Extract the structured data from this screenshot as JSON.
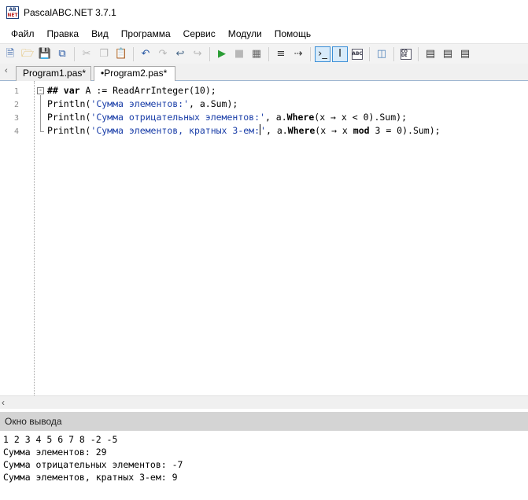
{
  "window": {
    "title": "PascalABC.NET 3.7.1",
    "icon_letters_top": "AB",
    "icon_letters_bottom": "NET"
  },
  "menu": [
    "Файл",
    "Правка",
    "Вид",
    "Программа",
    "Сервис",
    "Модули",
    "Помощь"
  ],
  "toolbar": {
    "icons": [
      "new-file-icon",
      "open-folder-icon",
      "save-icon",
      "save-all-icon",
      "cut-icon",
      "copy-icon",
      "paste-icon",
      "undo-icon",
      "redo-icon",
      "compile-icon",
      "stop-compile-icon",
      "run-icon",
      "stop-icon",
      "debug-icon",
      "step-icon",
      "step-over-icon",
      "console-icon",
      "format-icon",
      "abc-icon",
      "insert-snippet-icon",
      "code-icon",
      "bookmark-d-icon",
      "bookmark-l-icon",
      "bookmark-r-icon"
    ],
    "code_button_label": "CO DE",
    "abc_button_label": "ABC"
  },
  "tabs": [
    {
      "label": "Program1.pas*",
      "active": false
    },
    {
      "label": "•Program2.pas*",
      "active": true
    }
  ],
  "editor": {
    "line_numbers": [
      "1",
      "2",
      "3",
      "4"
    ],
    "lines": [
      [
        {
          "t": "## ",
          "c": "kw"
        },
        {
          "t": "var",
          "c": "kw"
        },
        {
          "t": " A := ReadArrInteger(",
          "c": "op"
        },
        {
          "t": "10",
          "c": "num"
        },
        {
          "t": ");",
          "c": "op"
        }
      ],
      [
        {
          "t": "Println(",
          "c": "op"
        },
        {
          "t": "'Сумма элементов:'",
          "c": "str"
        },
        {
          "t": ", a.Sum);",
          "c": "op"
        }
      ],
      [
        {
          "t": "Println(",
          "c": "op"
        },
        {
          "t": "'Сумма отрицательных элементов:'",
          "c": "str"
        },
        {
          "t": ", a.",
          "c": "op"
        },
        {
          "t": "Where",
          "c": "kw"
        },
        {
          "t": "(x → x < ",
          "c": "op"
        },
        {
          "t": "0",
          "c": "num"
        },
        {
          "t": ").Sum);",
          "c": "op"
        }
      ],
      [
        {
          "t": "Println(",
          "c": "op"
        },
        {
          "t": "'Сумма элементов, кратных 3-ем:",
          "c": "str"
        },
        {
          "t": "|caret|",
          "c": "caret"
        },
        {
          "t": "'",
          "c": "str"
        },
        {
          "t": ", a.",
          "c": "op"
        },
        {
          "t": "Where",
          "c": "kw"
        },
        {
          "t": "(x → x ",
          "c": "op"
        },
        {
          "t": "mod",
          "c": "kw"
        },
        {
          "t": " 3 = ",
          "c": "op"
        },
        {
          "t": "0",
          "c": "num"
        },
        {
          "t": ").Sum);",
          "c": "op"
        }
      ]
    ]
  },
  "output": {
    "title": "Окно вывода",
    "lines": [
      "1 2 3 4 5 6 7 8 -2 -5",
      "Сумма элементов: 29",
      "Сумма отрицательных элементов: -7",
      "Сумма элементов, кратных 3-ем: 9"
    ]
  }
}
